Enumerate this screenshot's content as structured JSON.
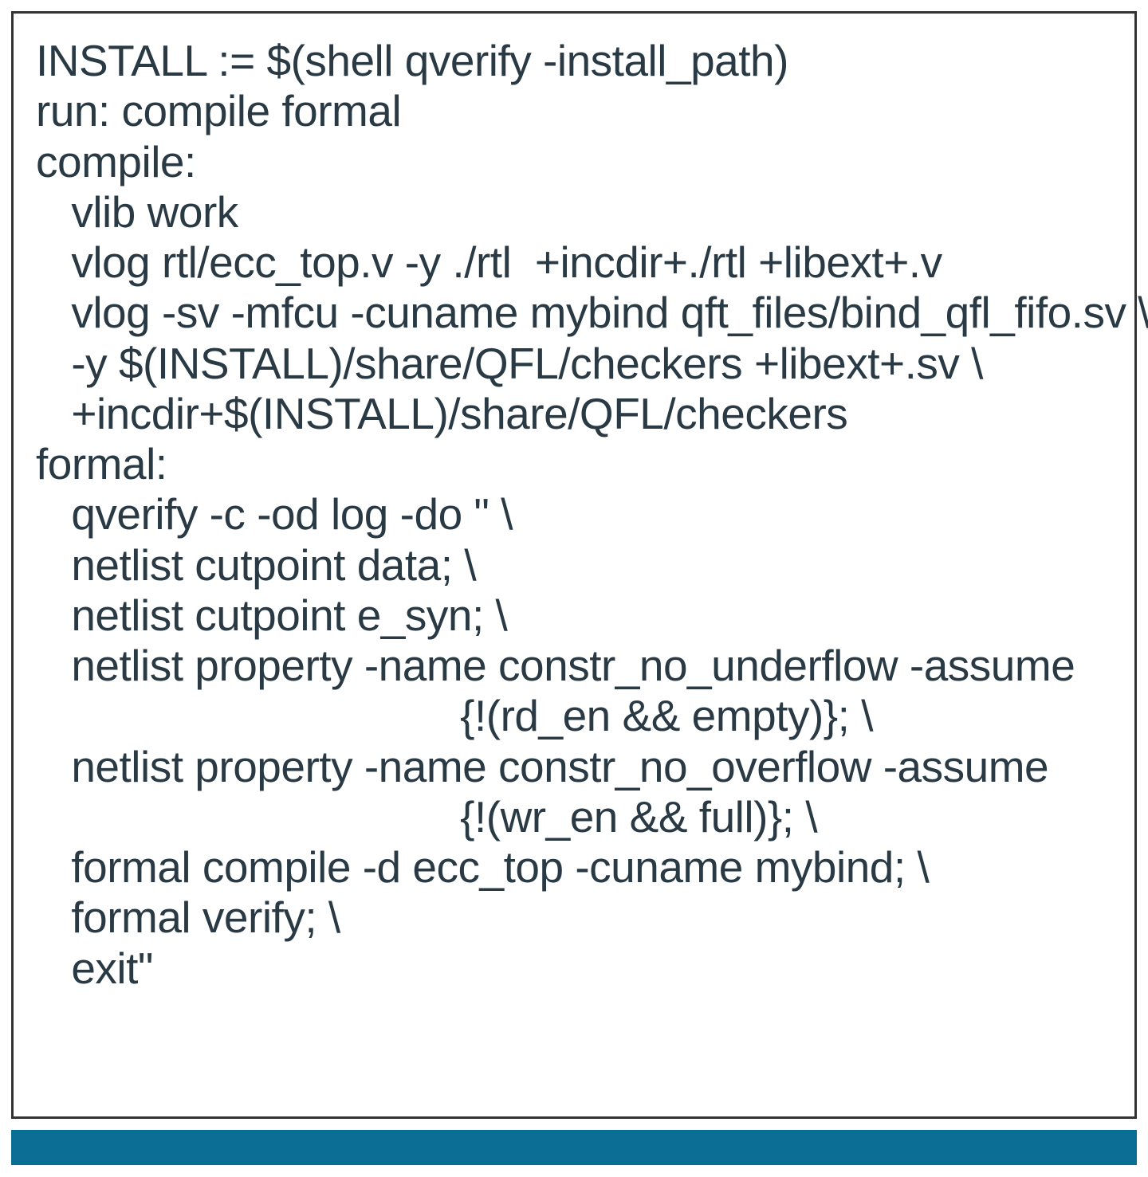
{
  "code": {
    "lines": [
      "INSTALL := $(shell qverify -install_path)",
      "run: compile formal",
      "compile:",
      "   vlib work",
      "   vlog rtl/ecc_top.v -y ./rtl  +incdir+./rtl +libext+.v",
      "   vlog -sv -mfcu -cuname mybind qft_files/bind_qfl_fifo.sv \\",
      "   -y $(INSTALL)/share/QFL/checkers +libext+.sv \\",
      "   +incdir+$(INSTALL)/share/QFL/checkers",
      "formal:",
      "   qverify -c -od log -do \" \\",
      "   netlist cutpoint data; \\",
      "   netlist cutpoint e_syn; \\",
      "   netlist property -name constr_no_underflow -assume",
      "                                    {!(rd_en && empty)}; \\",
      "   netlist property -name constr_no_overflow -assume",
      "                                    {!(wr_en && full)}; \\",
      "   formal compile -d ecc_top -cuname mybind; \\",
      "   formal verify; \\",
      "   exit\""
    ]
  }
}
